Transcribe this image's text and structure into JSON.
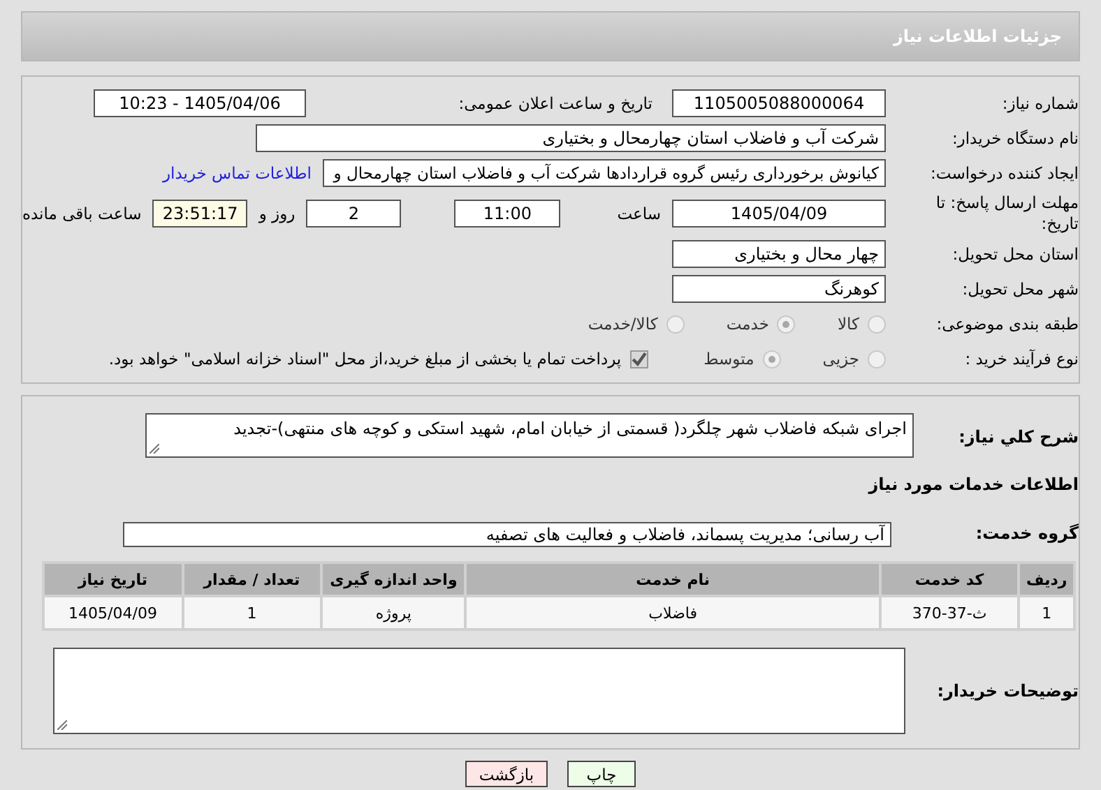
{
  "header": {
    "title": "جزئیات اطلاعات نیاز"
  },
  "need_number": {
    "label": "شماره نیاز:",
    "value": "1105005088000064"
  },
  "announce": {
    "label": "تاریخ و ساعت اعلان عمومی:",
    "value": "1405/04/06 - 10:23"
  },
  "buyer": {
    "label": "نام دستگاه خریدار:",
    "value": "شرکت آب و فاضلاب استان چهارمحال و بختیاری"
  },
  "creator": {
    "label": "ایجاد کننده درخواست:",
    "value": "کیانوش برخورداری رئیس گروه قراردادها شرکت آب و فاضلاب استان چهارمحال و",
    "link": "اطلاعات تماس خریدار"
  },
  "deadline": {
    "label": "مهلت ارسال پاسخ: تا تاریخ:",
    "date": "1405/04/09",
    "time_label": "ساعت",
    "time": "11:00",
    "days": "2",
    "days_label": "روز و",
    "remaining": "23:51:17",
    "remaining_label": "ساعت باقی مانده"
  },
  "province": {
    "label": "استان محل تحویل:",
    "value": "چهار محال و بختیاری"
  },
  "city": {
    "label": "شهر محل تحویل:",
    "value": "کوهرنگ"
  },
  "category": {
    "label": "طبقه بندی موضوعی:",
    "options": [
      {
        "label": "کالا",
        "selected": false
      },
      {
        "label": "خدمت",
        "selected": true
      },
      {
        "label": "کالا/خدمت",
        "selected": false
      }
    ]
  },
  "process": {
    "label": "نوع فرآیند خرید :",
    "options": [
      {
        "label": "جزیی",
        "selected": false
      },
      {
        "label": "متوسط",
        "selected": true
      }
    ],
    "payment": {
      "checked": true,
      "text": "پرداخت تمام یا بخشی از مبلغ خرید،از محل \"اسناد خزانه اسلامی\" خواهد بود."
    }
  },
  "description": {
    "label": "شرح کلي نياز:",
    "value": "اجرای شبکه فاضلاب شهر چلگرد( قسمتی از خیابان امام، شهید استکی و کوچه های منتهی)-تجدید"
  },
  "services_heading": "اطلاعات خدمات مورد نیاز",
  "service_group": {
    "label": "گروه خدمت:",
    "value": "آب رسانی؛ مدیریت پسماند، فاضلاب و فعالیت های تصفیه"
  },
  "table": {
    "columns": [
      "ردیف",
      "کد خدمت",
      "نام خدمت",
      "واحد اندازه گیری",
      "تعداد / مقدار",
      "تاریخ نیاز"
    ],
    "rows": [
      [
        "1",
        "ث-37-370",
        "فاضلاب",
        "پروژه",
        "1",
        "1405/04/09"
      ]
    ]
  },
  "buyer_notes": {
    "label": "توضیحات خریدار:"
  },
  "buttons": [
    {
      "label": "چاپ",
      "kind": "print"
    },
    {
      "label": "بازگشت",
      "kind": "back"
    }
  ]
}
